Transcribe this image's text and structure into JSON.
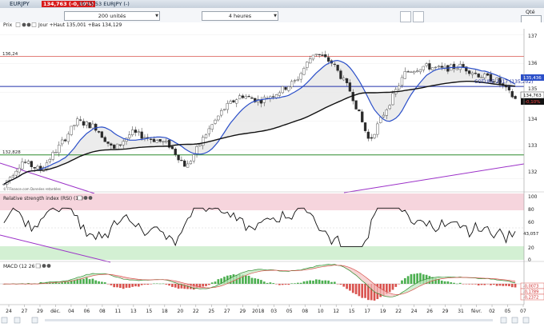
{
  "window": {
    "ticker": "EURJPY",
    "quote_badge": "134,763 (-0,10%)",
    "time": "19:15:53 EURJPY (-)"
  },
  "toolbar": {
    "units_select": "200 unités",
    "period_select": "4 heures",
    "qty_label": "Qté"
  },
  "price_panel": {
    "header": "Prix",
    "header_values": "Jour +Haut 135,001 +Bas 134,129",
    "source_note": "© FFinance.com  Données retardées",
    "level_136": "136,24",
    "level_1328": "132,828",
    "coture_label": "COTURE 2017 (135,202)",
    "badge_ma": "135,436",
    "badge_135": "135",
    "badge_last": "134,763",
    "badge_pct": "-0,10%",
    "y_ticks": [
      "137",
      "136",
      "135",
      "134",
      "133",
      "132"
    ]
  },
  "rsi_panel": {
    "header": "Relative strength index (RSI) (14)",
    "value_badge": "43,057",
    "y_ticks": [
      "100",
      "80",
      "60",
      "40",
      "20",
      "0"
    ]
  },
  "macd_panel": {
    "header": "MACD (12 26 9)",
    "badges": [
      "-0,0073",
      "-0,1789",
      "-0,2372"
    ]
  },
  "x_axis": {
    "labels": [
      "24",
      "27",
      "29",
      "déc.",
      "04",
      "06",
      "08",
      "11",
      "13",
      "15",
      "18",
      "20",
      "22",
      "25",
      "27",
      "29",
      "2018",
      "03",
      "05",
      "08",
      "10",
      "12",
      "15",
      "17",
      "19",
      "22",
      "24",
      "26",
      "29",
      "31",
      "févr.",
      "02",
      "05",
      "07"
    ]
  },
  "colors": {
    "candle_up": "#ffffff",
    "candle_down": "#2a2a2a",
    "ma_short": "#2b4fc9",
    "ma_long": "#111111",
    "resistance": "#d9534f",
    "coture": "#2233aa",
    "support": "#2e8b2e",
    "trendline": "#9b30c8",
    "rsi_overbought_zone": "#f6d5dd",
    "rsi_oversold_zone": "#d3f0d3",
    "macd_up": "#4caf50",
    "macd_down": "#d9534f",
    "quote_badge": "#d81b1b"
  },
  "chart_data": [
    {
      "type": "candlestick",
      "title": "EURJPY",
      "period": "4 heures",
      "ylim": [
        131.6,
        137.2
      ],
      "x_categories": [
        "24",
        "27",
        "29",
        "déc.",
        "04",
        "06",
        "08",
        "11",
        "13",
        "15",
        "18",
        "20",
        "22",
        "25",
        "27",
        "29",
        "2018",
        "03",
        "05",
        "08",
        "10",
        "12",
        "15",
        "17",
        "19",
        "22",
        "24",
        "26",
        "29",
        "31",
        "févr.",
        "02",
        "05",
        "07"
      ],
      "close_path": [
        [
          0,
          131.8
        ],
        [
          1,
          132.6
        ],
        [
          2,
          132.3
        ],
        [
          3,
          133.1
        ],
        [
          4,
          134.0
        ],
        [
          5,
          133.8
        ],
        [
          6,
          133.0
        ],
        [
          7,
          133.6
        ],
        [
          8,
          133.4
        ],
        [
          9,
          133.2
        ],
        [
          10,
          132.4
        ],
        [
          11,
          133.5
        ],
        [
          12,
          134.4
        ],
        [
          13,
          134.9
        ],
        [
          14,
          134.7
        ],
        [
          15,
          135.0
        ],
        [
          16,
          135.4
        ],
        [
          17,
          136.4
        ],
        [
          18,
          136.0
        ],
        [
          19,
          135.0
        ],
        [
          20,
          133.3
        ],
        [
          21,
          134.5
        ],
        [
          22,
          135.7
        ],
        [
          23,
          135.9
        ],
        [
          24,
          135.8
        ],
        [
          25,
          135.9
        ],
        [
          26,
          135.6
        ],
        [
          27,
          135.4
        ],
        [
          28,
          134.76
        ]
      ],
      "lines": {
        "resistance": 136.24,
        "coture_2017": 135.202,
        "support": 132.828
      },
      "moving_average_short_end": 135.436,
      "last_price": 134.763,
      "change_pct": -0.1
    },
    {
      "type": "line",
      "title": "Relative strength index (RSI) (14)",
      "ylim": [
        0,
        100
      ],
      "overbought": 70,
      "oversold": 30,
      "last": 43.057
    },
    {
      "type": "bar",
      "title": "MACD (12 26 9)",
      "values": [
        -0.0073,
        -0.1789,
        -0.2372
      ]
    }
  ]
}
